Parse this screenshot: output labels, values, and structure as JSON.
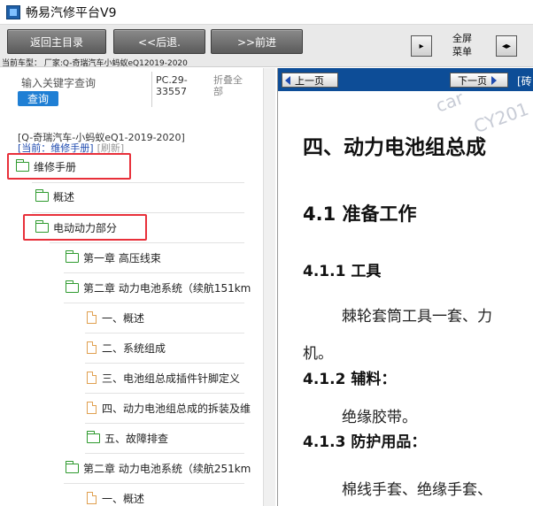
{
  "window": {
    "title": "畅易汽修平台V9"
  },
  "toolbar": {
    "back_label": "返回主目录",
    "prev_label": "<<后退.",
    "next_label": ">>前进",
    "fullscreen_line1": "全屏",
    "fullscreen_line2": "菜单"
  },
  "car_model": "当前车型：  厂家:Q-奇瑞汽车小蚂蚁eQ12019-2020",
  "search": {
    "placeholder": "输入关键字查询",
    "button": "查询",
    "pc_code": "PC.29-33557",
    "fold_all": "折叠全部"
  },
  "breadcrumb": {
    "vehicle": "[Q-奇瑞汽车-小蚂蚁eQ1-2019-2020]",
    "current": "[当前：维修手册]",
    "refresh": "[刷新]"
  },
  "tree": [
    {
      "label": "维修手册",
      "type": "folder"
    },
    {
      "label": "概述",
      "type": "folder"
    },
    {
      "label": "电动动力部分",
      "type": "folder"
    },
    {
      "label": "第一章 高压线束",
      "type": "folder"
    },
    {
      "label": "第二章 动力电池系统（续航151km",
      "type": "folder"
    },
    {
      "label": "一、概述",
      "type": "doc"
    },
    {
      "label": "二、系统组成",
      "type": "doc"
    },
    {
      "label": "三、电池组总成插件针脚定义",
      "type": "doc"
    },
    {
      "label": "四、动力电池组总成的拆装及维",
      "type": "doc"
    },
    {
      "label": "五、故障排查",
      "type": "folder"
    },
    {
      "label": "第二章 动力电池系统（续航251km",
      "type": "folder"
    },
    {
      "label": "一、概述",
      "type": "doc"
    }
  ],
  "viewer": {
    "prev_page": "上一页",
    "next_page": "下一页",
    "nav_extra": "[砖",
    "watermark1": "car",
    "watermark2": "CY201",
    "heading1": "四、动力电池组总成",
    "heading2": "4.1 准备工作",
    "sub1": "4.1.1 工具",
    "para1": "棘轮套筒工具一套、力",
    "para1b": "机。",
    "sub2": "4.1.2 辅料：",
    "para2": "绝缘胶带。",
    "sub3": "4.1.3 防护用品：",
    "para3": "棉线手套、绝缘手套、"
  },
  "colors": {
    "accent_blue": "#1f7fd4",
    "nav_bar": "#0d4d97",
    "highlight_red": "#e8303a",
    "folder_green": "#2e9a2e",
    "doc_orange": "#e0a050"
  }
}
